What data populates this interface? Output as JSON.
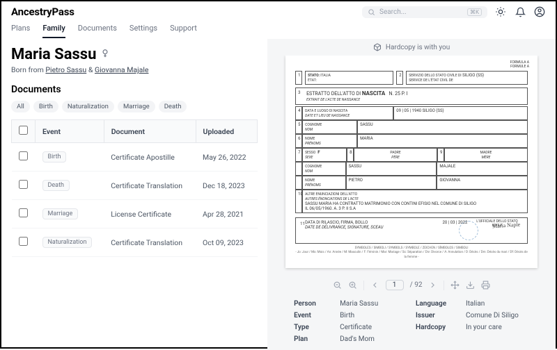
{
  "brand": "AncestryPass",
  "search": {
    "placeholder": "Search...",
    "kbd": "⌘K"
  },
  "nav": [
    "Plans",
    "Family",
    "Documents",
    "Settings",
    "Support"
  ],
  "nav_active": 1,
  "person": {
    "name": "Maria Sassu",
    "born_prefix": "Born from ",
    "parent1": "Pietro Sassu",
    "amp": " & ",
    "parent2": "Giovanna Majale"
  },
  "docs": {
    "title": "Documents",
    "filters": [
      "All",
      "Birth",
      "Naturalization",
      "Marriage",
      "Death"
    ],
    "headers": [
      "",
      "Event",
      "Document",
      "Uploaded"
    ],
    "rows": [
      {
        "event": "Birth",
        "doc": "Certificate Apostille",
        "uploaded": "May 26, 2022"
      },
      {
        "event": "Death",
        "doc": "Certificate Translation",
        "uploaded": "Dec 18, 2023"
      },
      {
        "event": "Marriage",
        "doc": "License Certificate",
        "uploaded": "Apr 28, 2021"
      },
      {
        "event": "Naturalization",
        "doc": "Certificate Translation",
        "uploaded": "Oct 09, 2023"
      }
    ]
  },
  "hardcopy_bar": "Hardcopy is with you",
  "viewer": {
    "page": "1",
    "total": "/ 92"
  },
  "meta": {
    "person_k": "Person",
    "person_v": "Maria Sassu",
    "language_k": "Language",
    "language_v": "Italian",
    "event_k": "Event",
    "event_v": "Birth",
    "issuer_k": "Issuer",
    "issuer_v": "Comune Di Siligo",
    "type_k": "Type",
    "type_v": "Certificate",
    "hardcopy_k": "Hardcopy",
    "hardcopy_v": "In your care",
    "plan_k": "Plan",
    "plan_v": "Dad's Mom"
  },
  "doc_form": {
    "formula": "FORMULA A\nFORMULE A",
    "stato_lbl": "STATO:",
    "stato_sub": "ÉTAT:",
    "stato_val": "ITALIA",
    "box2": "2",
    "servizio": "SERVIZIO DELLO STATO CIVILE DI",
    "servizio_sub": "SERVICE DE L'ÉTAT CIVIL DE",
    "servizio_val": "SILIGO (SS)",
    "box3": "3",
    "title_main": "ESTRATTO DELL'ATTO DI ",
    "title_bold": "NASCITA",
    "title_sub": "EXTRAIT DE L'ACTE DE NAISSANCE",
    "title_n": "N.",
    "title_nval": "25  P. I",
    "r4_n": "4",
    "r4_lbl": "DATA E LUOGO DI NASCITA",
    "r4_sub": "DATE ET LIEU DE NAISSANCE",
    "r4_val": "09 | 05 | 1940    SILIGO (SS)",
    "r5_n": "5",
    "r5_lbl": "COGNOME",
    "r5_sub": "NOM",
    "r5_val": "SASSU",
    "r6_n": "6",
    "r6_lbl": "NOME",
    "r6_sub": "PRÉNOMS",
    "r6_val": "MARIA",
    "r7_n": "7",
    "r7_lbl": "SESSO",
    "r7_sub": "SEXE",
    "r7_val": "F",
    "r7b_n": "8",
    "r7b_lbl": "PADRE",
    "r7b_sub": "PÈRE",
    "r7c_n": "9",
    "r7c_lbl": "MADRE",
    "r7c_sub": "MÈRE",
    "r8_lbl": "COGNOME",
    "r8_sub": "NOM",
    "r8_val1": "SASSU",
    "r8_val2": "MAJALE",
    "r9_lbl": "NOME",
    "r9_sub": "PRÉNOMS",
    "r9_val1": "PIETRO",
    "r9_val2": "GIOVANNA",
    "r10_n": "10",
    "r10_lbl": "ALTRE ENUNCIAZIONI DELL'ATTO",
    "r10_sub": "AUTRES ÉNONCIATIONS DE L'ACTE",
    "r10_txt": "SASSU MARIA HA CONTRATTO MATRIMONIO CON CONTINI EFISIO NEL COMUNE DI SILIGO\nIL 06/05/1960. A. 3 P. II S.A",
    "r11_n": "11",
    "r11_lbl": "DATA DI RILASCIO, FIRMA, BOLLO",
    "r11_sub": "DATE DE DÉLIVRANCE, SIGNATURE, SCEAU",
    "r11_date": "20 | 03 | 2022",
    "ufficiale": "L'UFFICIALE DELLO STATO CIVILE",
    "sig": "Maria Naple",
    "symbols1": "SYMBOLES / SIMBOLI / SYMBOLS / SYMBOLE / ZEICHEN / SÍMBOLOS / SIMBOLI",
    "symbols2": "- Jo: Jour / Mo: Mois / An: Année / M: Masculin / F: Féminin / Mar: Mariage / Sc: Séparation / Div: Divorce / A: Annulation / D: Décès / Dm: Décès du mari / Df: Décès de la femme -"
  }
}
